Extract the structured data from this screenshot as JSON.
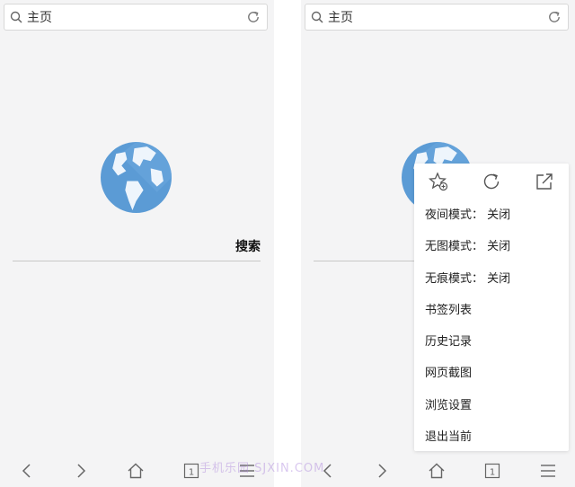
{
  "left_screen": {
    "address_bar": {
      "text": "主页"
    },
    "search": {
      "button_label": "搜索"
    },
    "bottom_nav": {
      "tabs_count": "1"
    }
  },
  "right_screen": {
    "address_bar": {
      "text": "主页"
    },
    "menu": {
      "top_icons": [
        "star-add-icon",
        "refresh-icon",
        "share-icon"
      ],
      "items": [
        {
          "label": "夜间模式：  关闭"
        },
        {
          "label": "无图模式：  关闭"
        },
        {
          "label": "无痕模式：  关闭"
        },
        {
          "label": "书签列表"
        },
        {
          "label": "历史记录"
        },
        {
          "label": "网页截图"
        },
        {
          "label": "浏览设置"
        },
        {
          "label": "退出当前"
        }
      ]
    },
    "bottom_nav": {
      "tabs_count": "1"
    }
  },
  "colors": {
    "globe_blue": "#5b9bd5",
    "background": "#f4f4f5"
  },
  "watermark": "手机乐园 SJXIN.COM"
}
